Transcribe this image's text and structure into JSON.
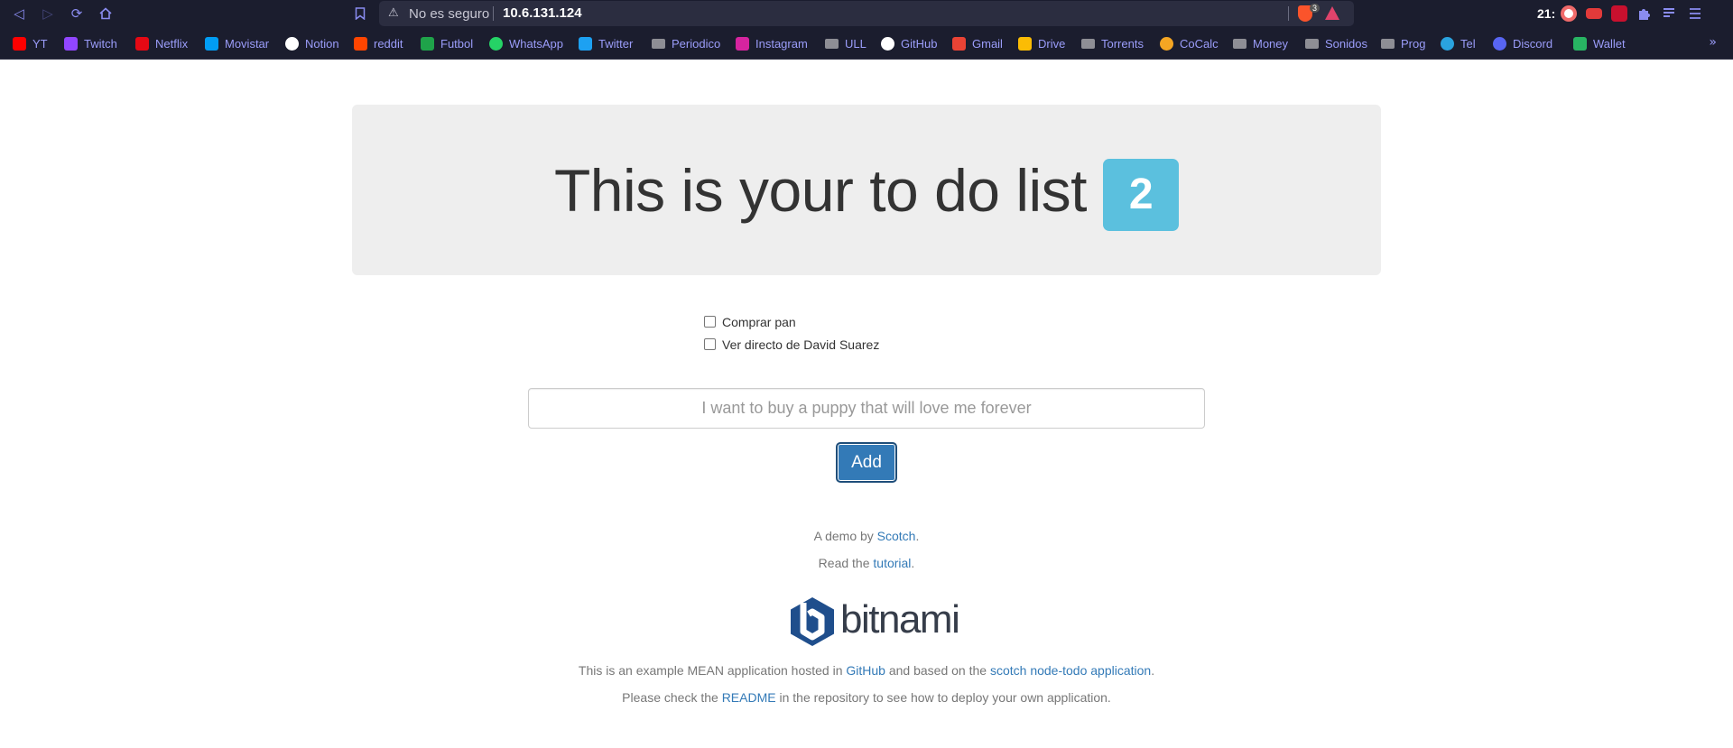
{
  "browser": {
    "security_label": "No es seguro",
    "url": "10.6.131.124",
    "shields_count": "3",
    "clock": "21:"
  },
  "bookmarks": [
    {
      "label": "YT",
      "icon": "youtube-icon",
      "color": "#ff0000"
    },
    {
      "label": "Twitch",
      "icon": "twitch-icon",
      "color": "#9146ff"
    },
    {
      "label": "Netflix",
      "icon": "netflix-icon",
      "color": "#e50914"
    },
    {
      "label": "Movistar",
      "icon": "movistar-icon",
      "color": "#019df4"
    },
    {
      "label": "Notion",
      "icon": "notion-icon",
      "color": "#ffffff"
    },
    {
      "label": "reddit",
      "icon": "reddit-icon",
      "color": "#ff4500"
    },
    {
      "label": "Futbol",
      "icon": "futbol-icon",
      "color": "#1fa34a"
    },
    {
      "label": "WhatsApp",
      "icon": "whatsapp-icon",
      "color": "#25d366"
    },
    {
      "label": "Twitter",
      "icon": "twitter-icon",
      "color": "#1da1f2"
    },
    {
      "label": "Periodico",
      "icon": "folder-icon",
      "color": "#8e8e95"
    },
    {
      "label": "Instagram",
      "icon": "instagram-icon",
      "color": "#d6249f"
    },
    {
      "label": "ULL",
      "icon": "folder-icon",
      "color": "#8e8e95"
    },
    {
      "label": "GitHub",
      "icon": "github-icon",
      "color": "#ffffff"
    },
    {
      "label": "Gmail",
      "icon": "gmail-icon",
      "color": "#ea4335"
    },
    {
      "label": "Drive",
      "icon": "drive-icon",
      "color": "#fbbc04"
    },
    {
      "label": "Torrents",
      "icon": "folder-icon",
      "color": "#8e8e95"
    },
    {
      "label": "CoCalc",
      "icon": "cocalc-icon",
      "color": "#f5a623"
    },
    {
      "label": "Money",
      "icon": "folder-icon",
      "color": "#8e8e95"
    },
    {
      "label": "Sonidos",
      "icon": "folder-icon",
      "color": "#8e8e95"
    },
    {
      "label": "Prog",
      "icon": "folder-icon",
      "color": "#8e8e95"
    },
    {
      "label": "Tel",
      "icon": "telegram-icon",
      "color": "#2aa3df"
    },
    {
      "label": "Discord",
      "icon": "discord-icon",
      "color": "#5865f2"
    },
    {
      "label": "Wallet",
      "icon": "wallet-icon",
      "color": "#28b463"
    }
  ],
  "page": {
    "heading": "This is your to do list",
    "todo_count": "2",
    "todos": [
      {
        "text": "Comprar pan",
        "checked": false
      },
      {
        "text": "Ver directo de David Suarez",
        "checked": false
      }
    ],
    "input_placeholder": "I want to buy a puppy that will love me forever",
    "add_label": "Add",
    "footer": {
      "demo_prefix": "A demo by ",
      "demo_link": "Scotch",
      "demo_suffix": ".",
      "read_prefix": "Read the ",
      "read_link": "tutorial",
      "read_suffix": ".",
      "logo_text": "bitnami",
      "example_prefix": "This is an example MEAN application hosted in ",
      "example_link1": "GitHub",
      "example_middle": " and based on the ",
      "example_link2": "scotch node-todo application",
      "example_suffix": ".",
      "check_prefix": "Please check the ",
      "check_link": "README",
      "check_suffix": " in the repository to see how to deploy your own application."
    }
  },
  "colors": {
    "accent": "#337ab7",
    "badge": "#5bc0de",
    "chrome_bg": "#1b1d2e",
    "bookmark_text": "#9b9dfa"
  }
}
